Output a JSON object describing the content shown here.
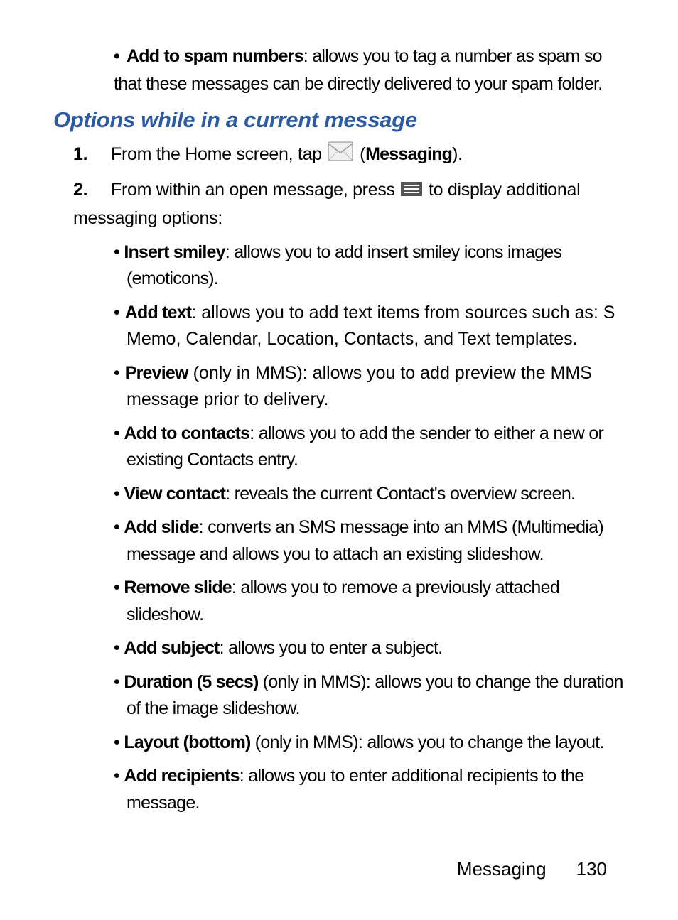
{
  "spam_bullet": {
    "term": "Add to spam numbers",
    "desc": ": allows you to tag a number as spam so that these messages can be directly delivered to your spam folder."
  },
  "heading": "Options while in a current message",
  "step1": {
    "num": "1.",
    "text_before": "From the Home screen, tap",
    "paren_open": "(",
    "messaging": "Messaging",
    "paren_close": ")."
  },
  "step2": {
    "num": "2.",
    "text_before": "From within an open message, press",
    "text_after": "to display additional messaging options:"
  },
  "options": [
    {
      "term": "Insert smiley",
      "desc": ": allows you to add insert smiley icons images (emoticons)."
    },
    {
      "term": "Add text",
      "desc": ": allows you to add text items from sources such as: S Memo, Calendar, Location, Contacts, and Text templates."
    },
    {
      "term": "Preview",
      "suffix": " (only in MMS)",
      "desc": ": allows you to add preview the MMS message prior to delivery."
    },
    {
      "term": "Add to contacts",
      "desc": ": allows you to add the sender to either a new or existing Contacts entry."
    },
    {
      "term": "View contact",
      "desc": ": reveals the current Contact's overview screen."
    },
    {
      "term": "Add slide",
      "desc": ": converts an SMS message into an MMS (Multimedia) message and allows you to attach an existing slideshow."
    },
    {
      "term": "Remove slide",
      "desc": ": allows you to remove a previously attached slideshow."
    },
    {
      "term": "Add subject",
      "desc": ": allows you to enter a subject."
    },
    {
      "term": "Duration (5 secs)",
      "suffix": " (only in MMS)",
      "desc": ": allows you to change the duration of the image slideshow."
    },
    {
      "term": "Layout (bottom)",
      "suffix": " (only in MMS)",
      "desc": ": allows you to change the layout."
    },
    {
      "term": "Add recipients",
      "desc": ": allows you to enter additional recipients to the message."
    }
  ],
  "footer": {
    "section": "Messaging",
    "page": "130"
  }
}
